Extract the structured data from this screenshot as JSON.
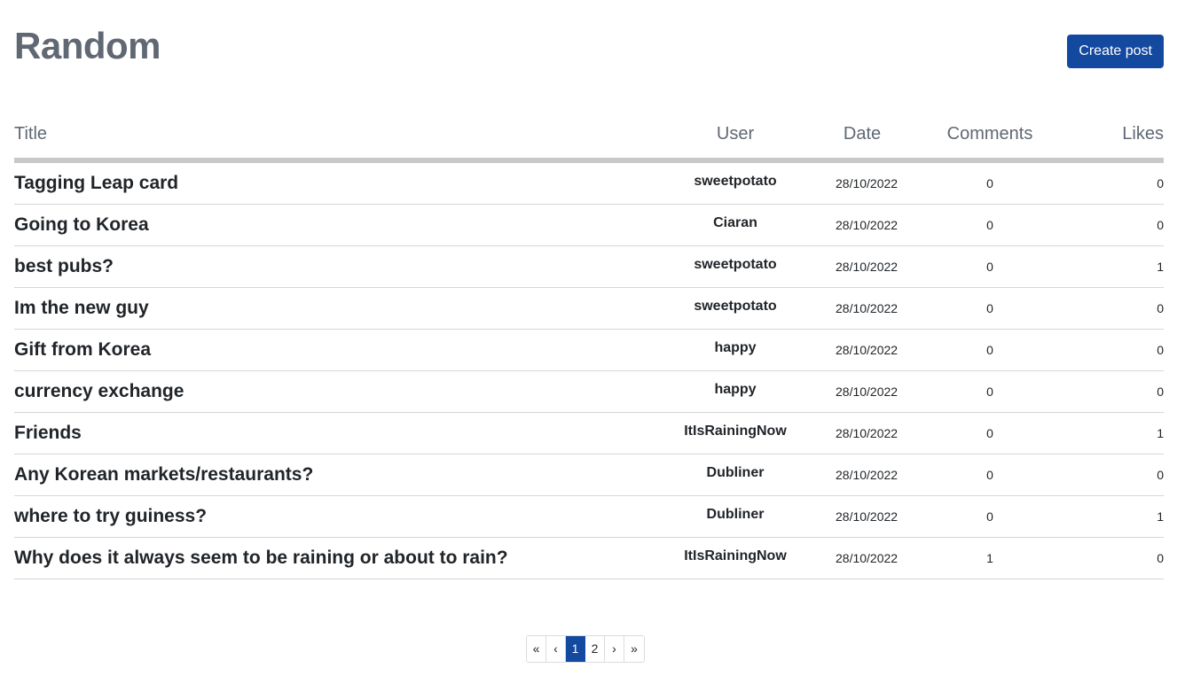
{
  "page": {
    "title": "Random",
    "create_button": "Create post"
  },
  "table": {
    "headers": {
      "title": "Title",
      "user": "User",
      "date": "Date",
      "comments": "Comments",
      "likes": "Likes"
    },
    "rows": [
      {
        "title": "Tagging Leap card",
        "user": "sweetpotato",
        "date": "28/10/2022",
        "comments": "0",
        "likes": "0"
      },
      {
        "title": "Going to Korea",
        "user": "Ciaran",
        "date": "28/10/2022",
        "comments": "0",
        "likes": "0"
      },
      {
        "title": "best pubs?",
        "user": "sweetpotato",
        "date": "28/10/2022",
        "comments": "0",
        "likes": "1"
      },
      {
        "title": "Im the new guy",
        "user": "sweetpotato",
        "date": "28/10/2022",
        "comments": "0",
        "likes": "0"
      },
      {
        "title": "Gift from Korea",
        "user": "happy",
        "date": "28/10/2022",
        "comments": "0",
        "likes": "0"
      },
      {
        "title": "currency exchange",
        "user": "happy",
        "date": "28/10/2022",
        "comments": "0",
        "likes": "0"
      },
      {
        "title": "Friends",
        "user": "ItIsRainingNow",
        "date": "28/10/2022",
        "comments": "0",
        "likes": "1"
      },
      {
        "title": "Any Korean markets/restaurants?",
        "user": "Dubliner",
        "date": "28/10/2022",
        "comments": "0",
        "likes": "0"
      },
      {
        "title": "where to try guiness?",
        "user": "Dubliner",
        "date": "28/10/2022",
        "comments": "0",
        "likes": "1"
      },
      {
        "title": "Why does it always seem to be raining or about to rain?",
        "user": "ItIsRainingNow",
        "date": "28/10/2022",
        "comments": "1",
        "likes": "0"
      }
    ]
  },
  "pagination": {
    "first": "«",
    "prev": "‹",
    "pages": [
      "1",
      "2"
    ],
    "current": "1",
    "next": "›",
    "last": "»"
  },
  "colors": {
    "accent": "#1449a0",
    "title": "#5f6873",
    "header_rule": "#c8c8c8"
  }
}
